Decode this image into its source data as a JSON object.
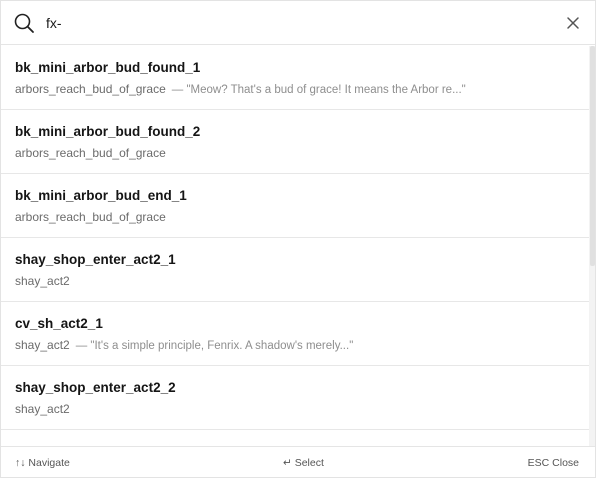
{
  "search": {
    "value": "fx-",
    "icon": "search-icon",
    "clear_icon": "close-icon"
  },
  "results": [
    {
      "title": "bk_mini_arbor_bud_found_1",
      "subtitle": "arbors_reach_bud_of_grace",
      "snippet": "— \"Meow? That's a bud of grace! It means the Arbor re...\""
    },
    {
      "title": "bk_mini_arbor_bud_found_2",
      "subtitle": "arbors_reach_bud_of_grace",
      "snippet": ""
    },
    {
      "title": "bk_mini_arbor_bud_end_1",
      "subtitle": "arbors_reach_bud_of_grace",
      "snippet": ""
    },
    {
      "title": "shay_shop_enter_act2_1",
      "subtitle": "shay_act2",
      "snippet": ""
    },
    {
      "title": "cv_sh_act2_1",
      "subtitle": "shay_act2",
      "snippet": "— \"It's a simple principle, Fenrix. A shadow's merely...\""
    },
    {
      "title": "shay_shop_enter_act2_2",
      "subtitle": "shay_act2",
      "snippet": ""
    }
  ],
  "footer": {
    "navigate": "↑↓ Navigate",
    "select": "↵ Select",
    "close": "ESC Close"
  }
}
